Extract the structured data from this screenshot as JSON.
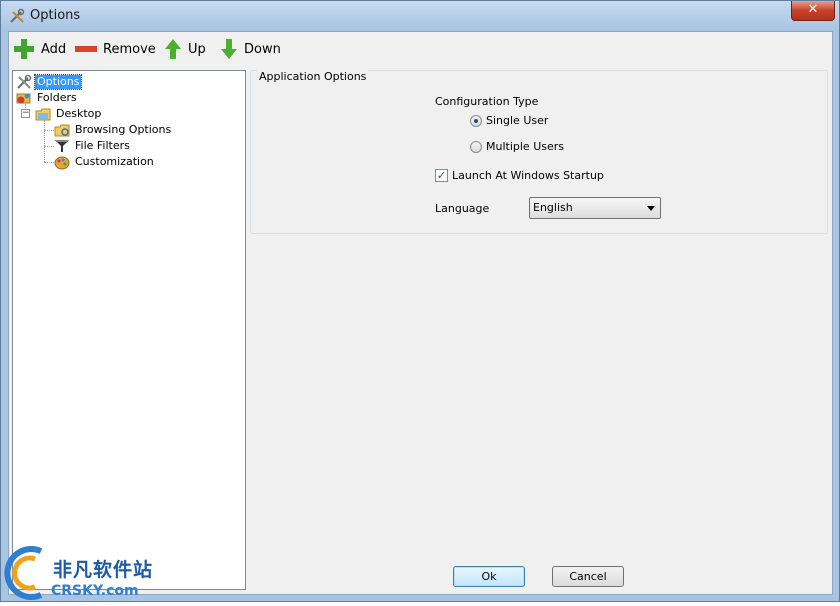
{
  "window": {
    "title": "Options",
    "close_glyph": "✕"
  },
  "toolbar": {
    "add_label": "Add",
    "remove_label": "Remove",
    "up_label": "Up",
    "down_label": "Down"
  },
  "tree": {
    "items": [
      {
        "label": "Options",
        "icon": "tools-icon",
        "selected": true
      },
      {
        "label": "Folders",
        "icon": "folders-icon"
      },
      {
        "label": "Desktop",
        "icon": "desktop-icon",
        "expander": "−"
      },
      {
        "label": "Browsing Options",
        "icon": "browse-folder-icon"
      },
      {
        "label": "File Filters",
        "icon": "funnel-icon"
      },
      {
        "label": "Customization",
        "icon": "palette-icon"
      }
    ]
  },
  "app_options": {
    "group_title": "Application Options",
    "config_type_label": "Configuration Type",
    "single_user_label": "Single User",
    "single_user_checked": true,
    "multiple_users_label": "Multiple Users",
    "multiple_users_checked": false,
    "launch_startup_label": "Launch At Windows Startup",
    "launch_startup_checked": true,
    "language_label": "Language",
    "language_value": "English"
  },
  "dialog": {
    "ok_label": "Ok",
    "cancel_label": "Cancel"
  },
  "watermark": {
    "line1": "非凡软件站",
    "line2": "CRSKY.com"
  },
  "colors": {
    "selection": "#3399ff",
    "add_green": "#3fa52f",
    "remove_red": "#d7432b",
    "arrow_green": "#4caf2e"
  }
}
